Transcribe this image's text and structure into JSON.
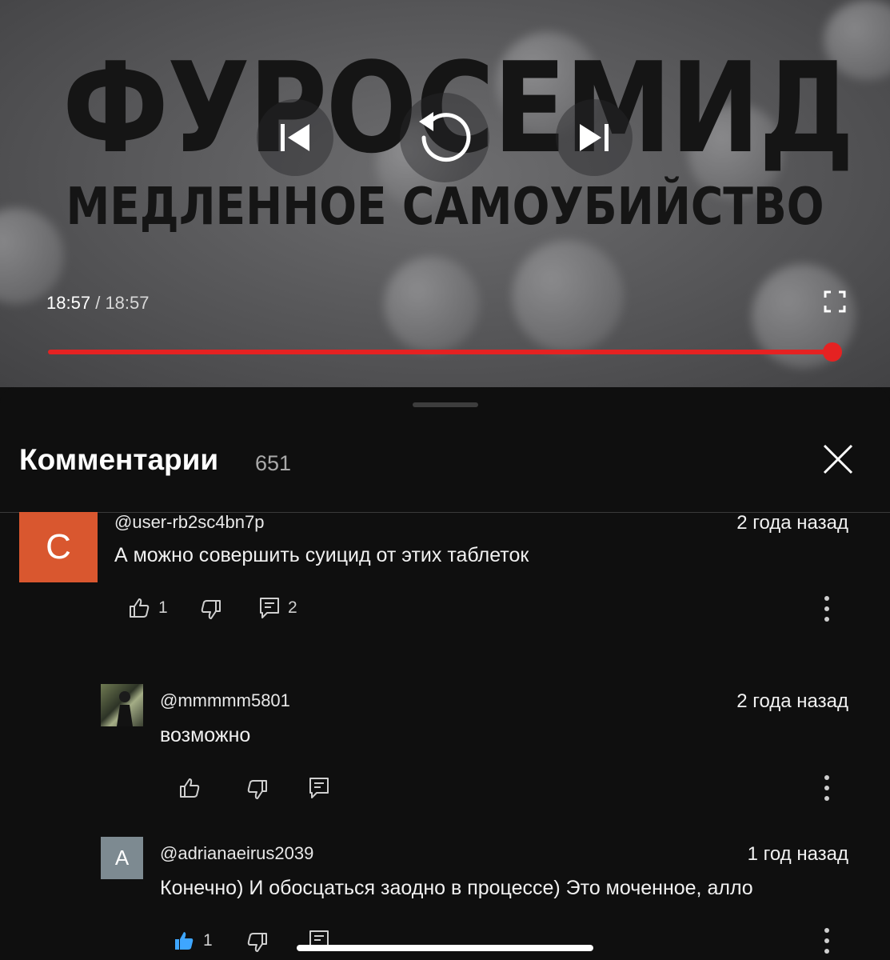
{
  "video": {
    "title_line1": "ФУРОСЕМИД",
    "title_line2": "МЕДЛЕННОЕ САМОУБИЙСТВО",
    "current_time": "18:57",
    "separator": "/",
    "duration": "18:57",
    "progress_percent": 100,
    "accent_color": "#e52222",
    "controls": [
      "previous-icon",
      "replay-icon",
      "next-icon",
      "fullscreen-icon"
    ]
  },
  "comments_panel": {
    "title": "Комментарии",
    "count": "651",
    "close_icon": "close-icon"
  },
  "comments": [
    {
      "avatar_letter": "С",
      "avatar_color": "#d9572f",
      "author": "@user-rb2sc4bn7p",
      "date": "2 года назад",
      "text": "А можно совершить суицид от этих таблеток",
      "likes": "1",
      "replies": "2"
    },
    {
      "avatar_letter": "",
      "author": "@mmmmm5801",
      "date": "2 года назад",
      "text": "возможно",
      "likes": "",
      "replies": ""
    },
    {
      "avatar_letter": "A",
      "avatar_color": "#7d8a91",
      "author": "@adrianaeirus2039",
      "date": "1 год назад",
      "text": "Конечно) И обосцаться заодно в процессе) Это моченное, алло",
      "likes": "1",
      "like_active_color": "#3ea6ff"
    }
  ]
}
